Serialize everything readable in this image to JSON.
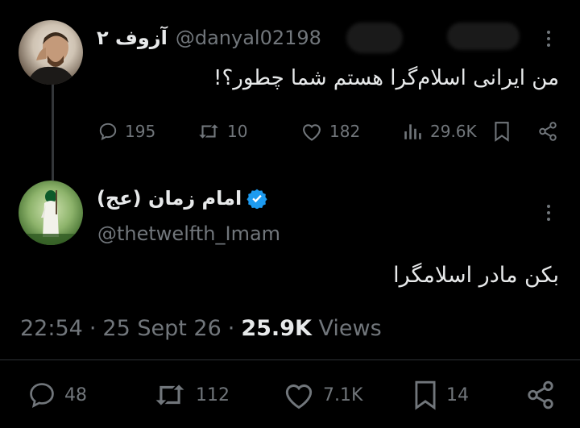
{
  "parent_tweet": {
    "display_name": "آزوف ۲",
    "handle": "@danyal02198",
    "text": "من ایرانی اسلام‌گرا هستم شما چطور؟!",
    "stats": {
      "replies": "195",
      "reposts": "10",
      "likes": "182",
      "views": "29.6K"
    }
  },
  "main_tweet": {
    "display_name": "امام زمان (عج)",
    "verified": true,
    "handle": "@thetwelfth_Imam",
    "text": "بکن مادر اسلامگرا",
    "time": "22:54",
    "date": "25 Sept 26",
    "views_count": "25.9K",
    "views_label": "Views",
    "separator": "·",
    "stats": {
      "replies": "48",
      "reposts": "112",
      "likes": "7.1K",
      "bookmarks": "14"
    }
  },
  "colors": {
    "background": "#000000",
    "text_primary": "#e7e9ea",
    "text_muted": "#71767b",
    "verified_blue": "#1d9bf0"
  },
  "icons": [
    "reply-icon",
    "repost-icon",
    "like-icon",
    "views-icon",
    "bookmark-icon",
    "share-icon",
    "more-icon",
    "verified-icon"
  ]
}
